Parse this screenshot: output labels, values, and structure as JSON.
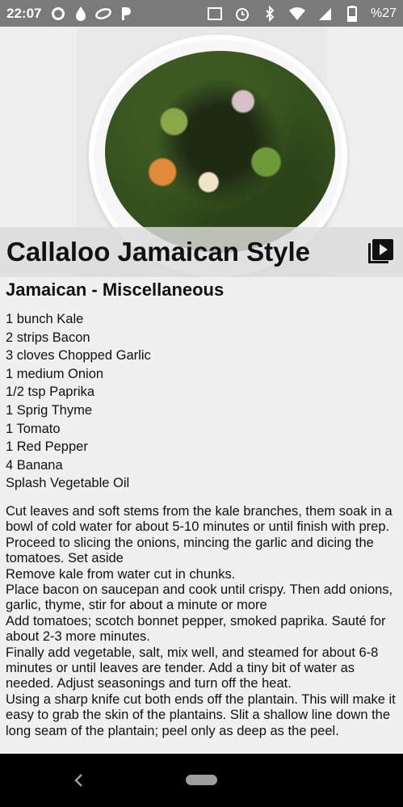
{
  "status_bar": {
    "time": "22:07",
    "battery": "%27",
    "left_icons": [
      "whatsapp-icon",
      "drop-icon",
      "leaf-icon",
      "p-icon"
    ],
    "right_icons": [
      "volte-icon",
      "alarm-icon",
      "bluetooth-icon",
      "wifi-icon",
      "signal-icon",
      "battery-icon"
    ]
  },
  "recipe": {
    "title": "Callaloo Jamaican Style",
    "category": "Jamaican - Miscellaneous",
    "ingredients": [
      "1  bunch Kale",
      "2 strips Bacon",
      "3 cloves Chopped Garlic",
      "1 medium Onion",
      "1/2 tsp Paprika",
      "1 Sprig Thyme",
      "1 Tomato",
      "1 Red Pepper",
      "4 Banana",
      "Splash Vegetable Oil"
    ],
    "instructions": [
      "Cut leaves and soft stems from the kale branches, them soak in a bowl of cold water for about 5-10 minutes or until finish with prep.",
      "Proceed to slicing the onions, mincing the garlic and dicing the tomatoes. Set aside",
      "Remove kale from water cut in chunks.",
      "Place bacon on saucepan and cook until crispy. Then add onions, garlic, thyme, stir for about a minute or more",
      "Add tomatoes; scotch bonnet pepper, smoked paprika. Sauté for about 2-3 more minutes.",
      "Finally add vegetable, salt, mix well, and steamed for about 6-8 minutes or until leaves are tender. Add a tiny bit of water as needed. Adjust seasonings and turn off the heat.",
      "Using a sharp knife cut both ends off the plantain. This will make it easy to grab the skin of the plantains. Slit a shallow line down the long seam of the plantain; peel only as deep as the peel."
    ]
  },
  "colors": {
    "status_bar": "#7a7a7a",
    "background": "#f0f0f0",
    "nav_bar": "#000000"
  }
}
